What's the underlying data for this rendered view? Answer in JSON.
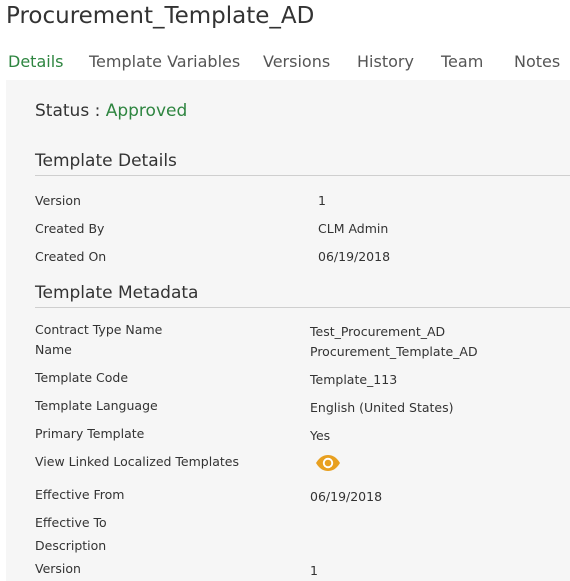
{
  "page": {
    "title": "Procurement_Template_AD"
  },
  "tabs": [
    {
      "label": "Details",
      "active": true
    },
    {
      "label": "Template Variables",
      "active": false
    },
    {
      "label": "Versions",
      "active": false
    },
    {
      "label": "History",
      "active": false
    },
    {
      "label": "Team",
      "active": false
    },
    {
      "label": "Notes",
      "active": false
    }
  ],
  "status": {
    "label": "Status : ",
    "value": "Approved"
  },
  "template_details": {
    "heading": "Template Details",
    "rows": [
      {
        "label": "Version",
        "value": "1"
      },
      {
        "label": "Created By",
        "value": "CLM Admin"
      },
      {
        "label": "Created On",
        "value": "06/19/2018"
      }
    ]
  },
  "template_metadata": {
    "heading": "Template Metadata",
    "rows": [
      {
        "label": "Contract Type Name",
        "value": "Test_Procurement_AD"
      },
      {
        "label": "Name",
        "value": "Procurement_Template_AD"
      },
      {
        "label": "Template Code",
        "value": "Template_113"
      },
      {
        "label": "Template Language",
        "value": "English (United States)"
      },
      {
        "label": "Primary Template",
        "value": "Yes"
      },
      {
        "label": "View Linked Localized Templates",
        "value": ""
      },
      {
        "label": "Effective From",
        "value": "06/19/2018"
      },
      {
        "label": "Effective To",
        "value": ""
      },
      {
        "label": "Description",
        "value": ""
      },
      {
        "label": "Version",
        "value": "1"
      }
    ]
  },
  "colors": {
    "accent_green": "#2e8540",
    "eye_icon": "#e8a020",
    "panel_bg": "#f6f6f6"
  },
  "icons": {
    "view_linked": "eye-icon"
  }
}
